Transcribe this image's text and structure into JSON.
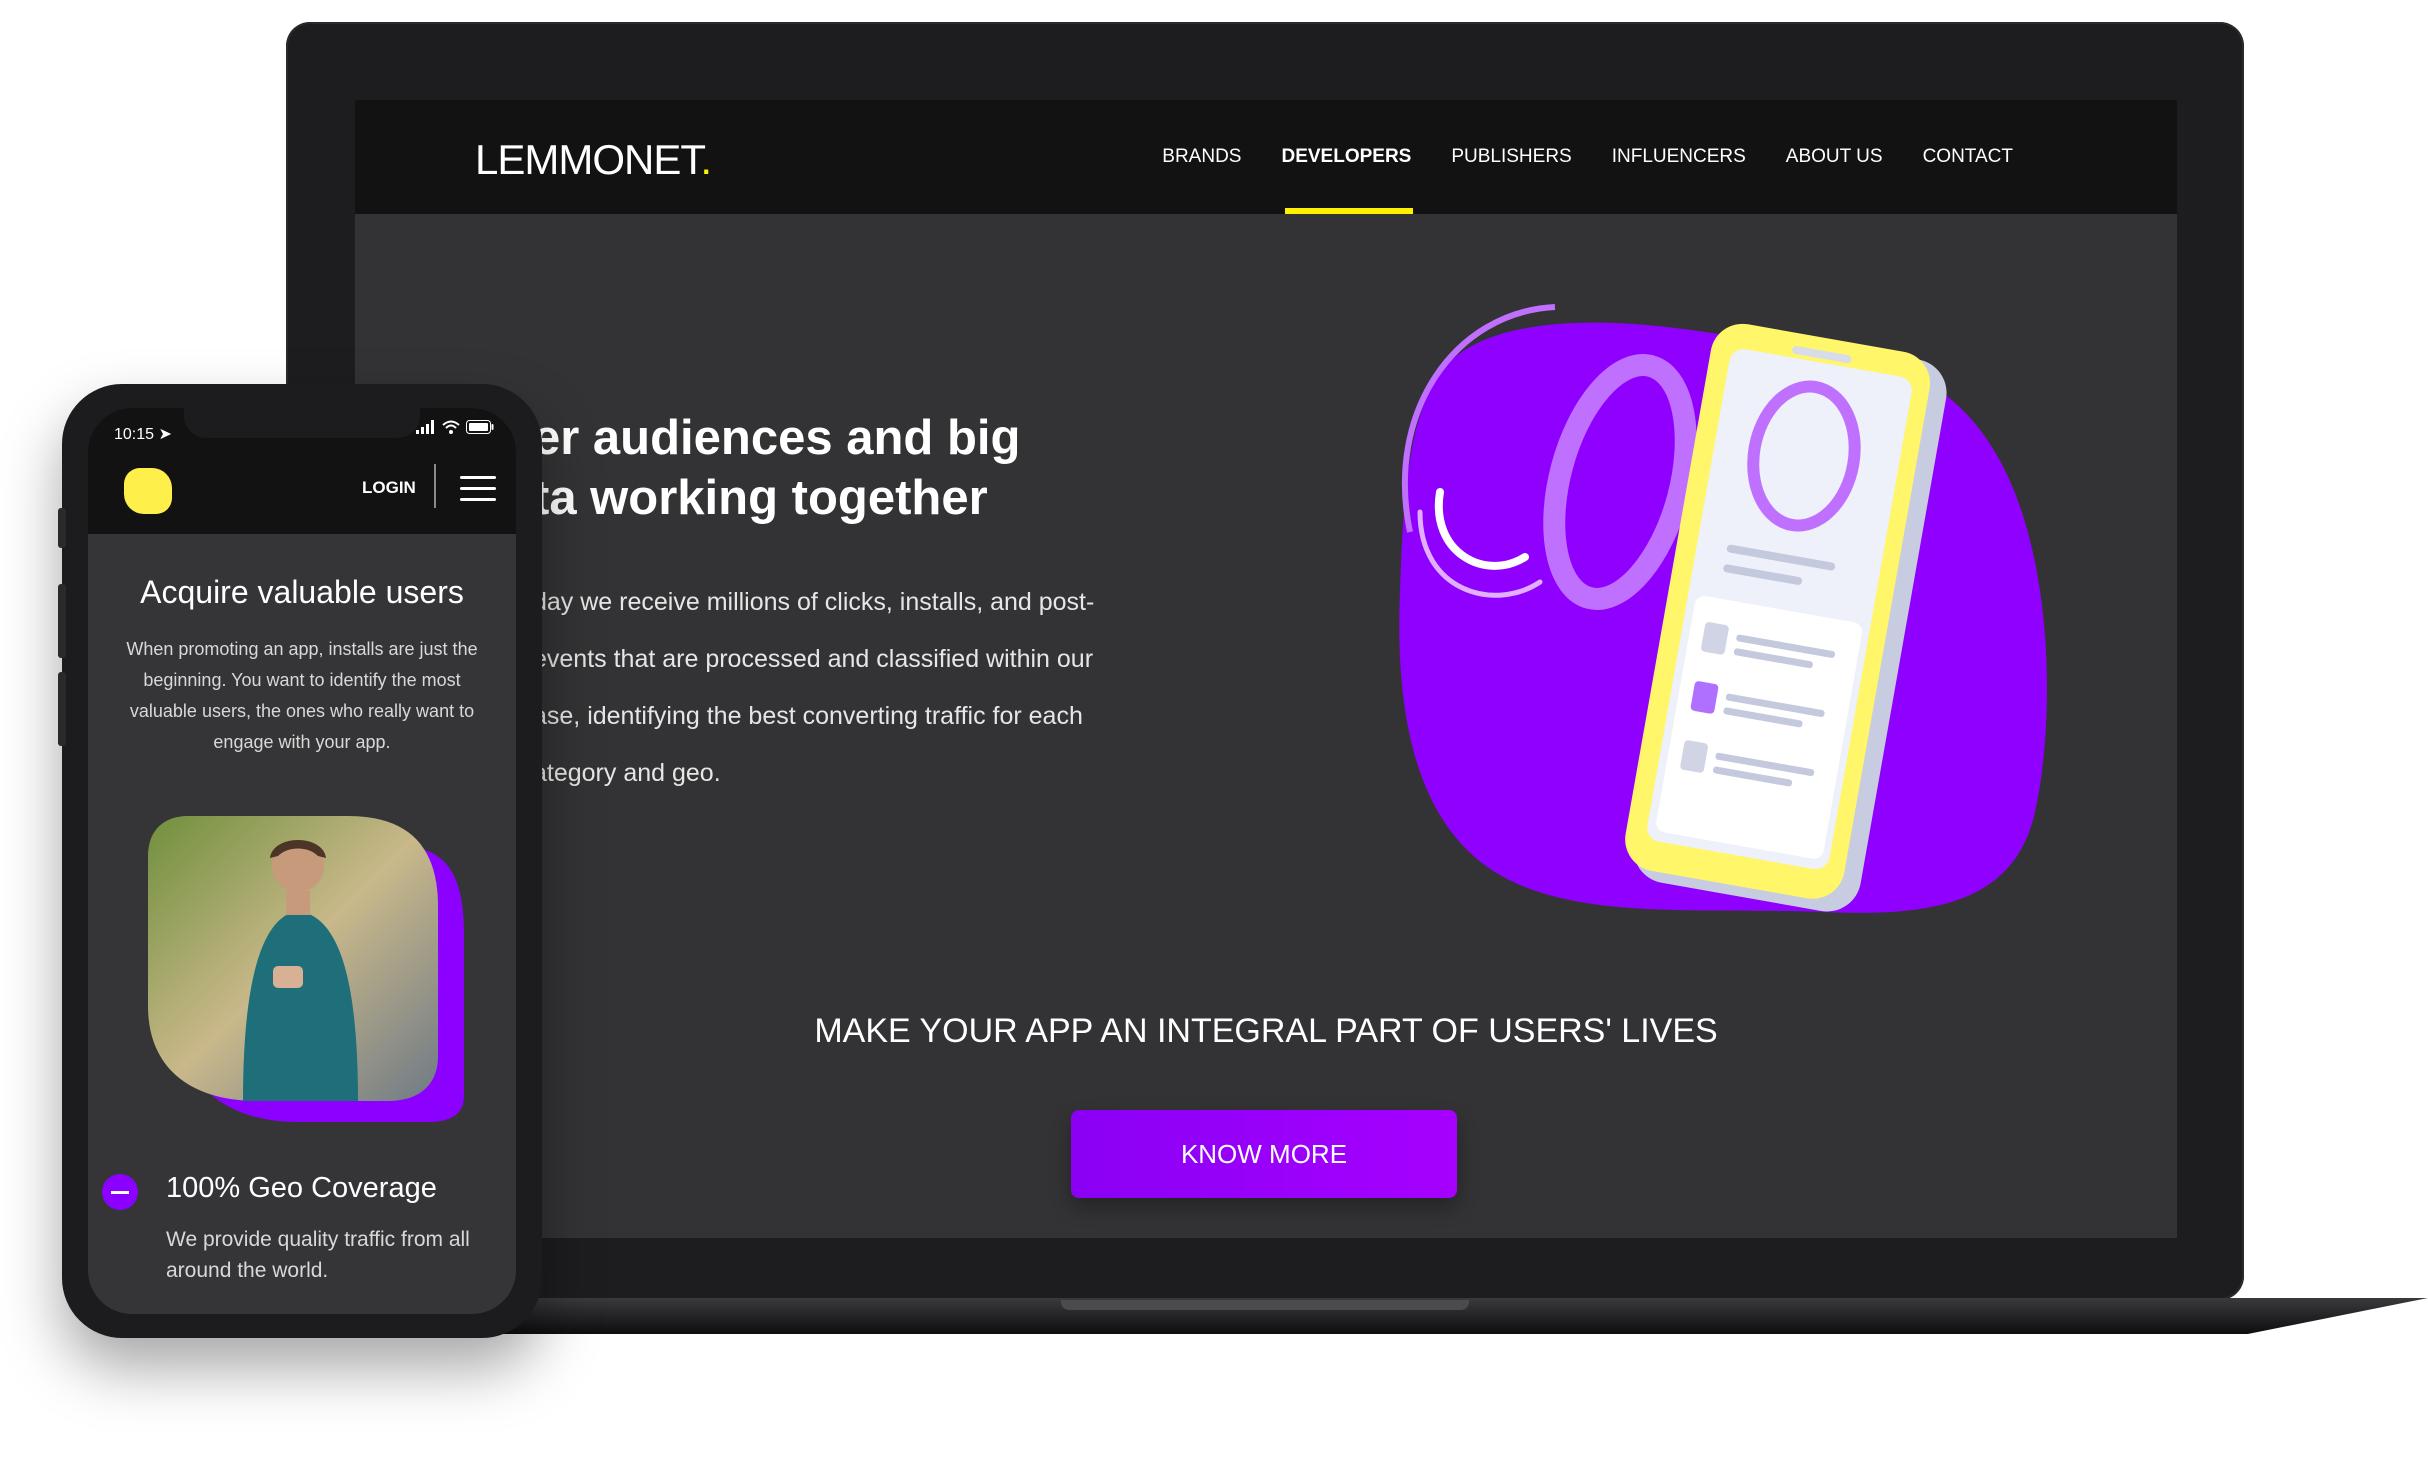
{
  "desktop": {
    "logo": "LEMMONET",
    "logo_dot": ".",
    "nav": [
      {
        "label": "BRANDS",
        "active": false
      },
      {
        "label": "DEVELOPERS",
        "active": true
      },
      {
        "label": "PUBLISHERS",
        "active": false
      },
      {
        "label": "INFLUENCERS",
        "active": false
      },
      {
        "label": "ABOUT US",
        "active": false
      },
      {
        "label": "CONTACT",
        "active": false
      }
    ],
    "hero": {
      "title_line1": "er audiences and big",
      "title_line2": "ta working together",
      "text_line1": "day we receive millions of clicks, installs, and post-",
      "text_line2": "events that are processed and classified within our",
      "text_line3": "ase, identifying the best converting traffic for each",
      "text_line4": "ategory and geo."
    },
    "tagline": "MAKE YOUR APP AN INTEGRAL PART OF USERS' LIVES",
    "cta_label": "KNOW MORE",
    "colors": {
      "accent_yellow": "#fff200",
      "brand_purple": "#8b00ff",
      "header_bg": "#121212",
      "page_bg": "#333335"
    }
  },
  "mobile": {
    "status_time": "10:15",
    "login_label": "LOGIN",
    "title": "Acquire valuable users",
    "description": "When promoting an app, installs are just the beginning. You want to identify the most valuable users, the ones who really want to engage with your app.",
    "feature_title": "100% Geo Coverage",
    "feature_text": "We provide quality traffic from all around the world."
  }
}
